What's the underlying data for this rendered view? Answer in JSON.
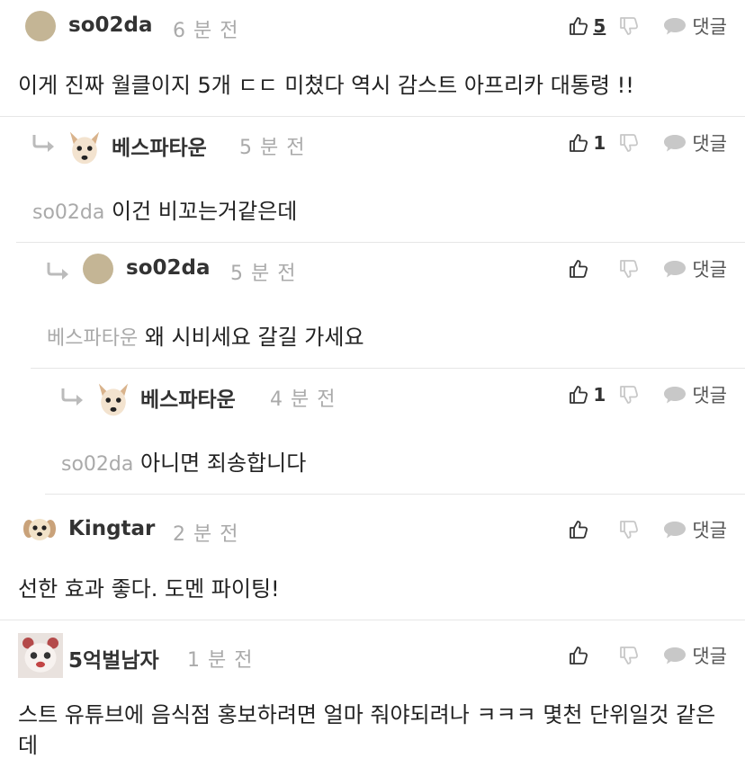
{
  "comments": [
    {
      "author": "so02da",
      "time": "6 분 전",
      "likes": "5",
      "reply_label": "댓글",
      "mention": "",
      "text": "이게 진짜 월클이지 5개 ㄷㄷ 미쳤다 역시 감스트 아프리카 대통령 !!"
    },
    {
      "author": "베스파타운",
      "time": "5 분 전",
      "likes": "1",
      "reply_label": "댓글",
      "mention": "so02da",
      "text": "이건 비꼬는거같은데"
    },
    {
      "author": "so02da",
      "time": "5 분 전",
      "likes": "",
      "reply_label": "댓글",
      "mention": "베스파타운",
      "text": "왜 시비세요 갈길 가세요"
    },
    {
      "author": "베스파타운",
      "time": "4 분 전",
      "likes": "1",
      "reply_label": "댓글",
      "mention": "so02da",
      "text": "아니면 죄송합니다"
    },
    {
      "author": "Kingtar",
      "time": "2 분 전",
      "likes": "",
      "reply_label": "댓글",
      "mention": "",
      "text": "선한 효과 좋다. 도멘 파이팅!"
    },
    {
      "author": "5억벌남자",
      "time": "1 분 전",
      "likes": "",
      "reply_label": "댓글",
      "mention": "",
      "text": "스트 유튜브에 음식점 홍보하려면 얼마 줘야되려나 ㅋㅋㅋ 몇천 단위일것 같은데"
    }
  ],
  "icons": {
    "like": "thumbs-up-icon",
    "dislike": "thumbs-down-icon",
    "reply": "speech-bubble-icon",
    "reply_arrow": "reply-arrow-icon"
  },
  "colors": {
    "avatar_plain": "#c4b595",
    "muted_text": "#aaaaaa",
    "divider": "#e6e6e6"
  }
}
